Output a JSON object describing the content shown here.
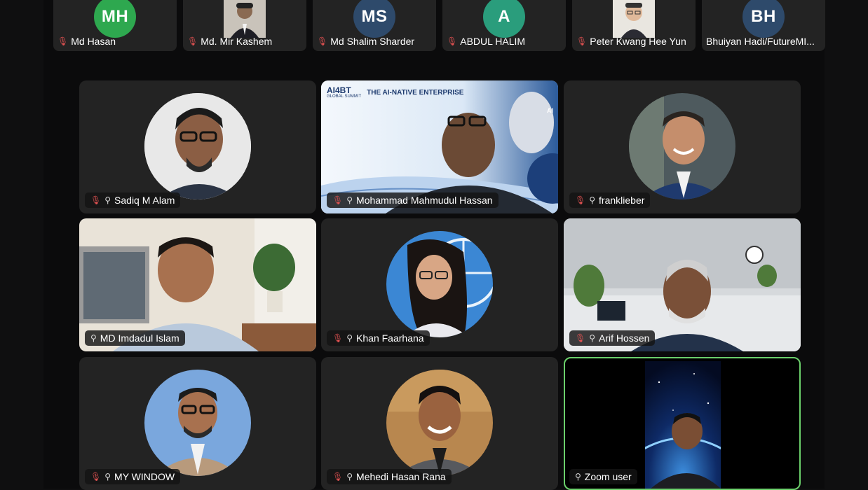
{
  "top_strip": [
    {
      "initials": "MH",
      "name": "Md Hasan",
      "avatar_color": "#2ea84f"
    },
    {
      "initials": "",
      "name": "Md. Mir Kashem",
      "avatar_color": "#6b5a4e"
    },
    {
      "initials": "MS",
      "name": "Md Shalim Sharder",
      "avatar_color": "#2e4a6b"
    },
    {
      "initials": "A",
      "name": "ABDUL HALIM",
      "avatar_color": "#2a9d7c"
    },
    {
      "initials": "",
      "name": "Peter Kwang Hee Yun",
      "avatar_color": "#d8d2c8"
    },
    {
      "initials": "BH",
      "name": "Bhuiyan Hadi/FutureMI...",
      "avatar_color": "#2e4a6b"
    }
  ],
  "tiles": [
    {
      "name": "Sadiq M Alam"
    },
    {
      "name": "Mohammad Mahmudul Hassan",
      "banner_logo": "AI4BT",
      "banner_sub": "GLOBAL SUMMIT",
      "banner_text": "THE AI-NATIVE ENTERPRISE",
      "banner_tag": "AI"
    },
    {
      "name": "franklieber"
    },
    {
      "name": "MD Imdadul Islam"
    },
    {
      "name": "Khan Faarhana"
    },
    {
      "name": "Arif Hossen"
    },
    {
      "name": "MY WINDOW"
    },
    {
      "name": "Mehedi Hasan Rana"
    },
    {
      "name": "Zoom user"
    }
  ],
  "icons": {
    "mic": "mic-muted-icon",
    "pin": "pin-icon"
  },
  "colors": {
    "muted_mic": "#e05151",
    "active_speaker": "#6bd06b",
    "tile_bg": "#232323"
  }
}
